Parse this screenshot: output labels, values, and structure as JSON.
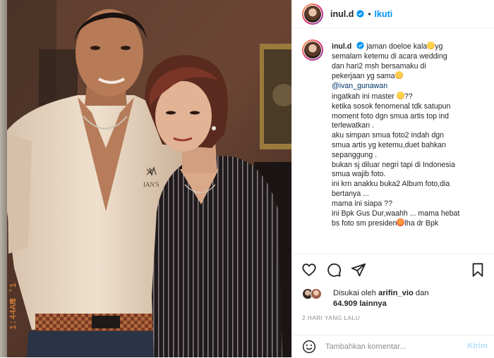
{
  "post": {
    "username": "inul.d",
    "follow_label": "Ikuti",
    "separator": "•",
    "photo_text": {
      "shirt_logo": "IAN'S",
      "date_stamp": "3 '1",
      "time_stamp": "1:44AM"
    }
  },
  "caption": {
    "username": "inul.d",
    "lines": [
      "jaman doeloe kala",
      "semalam ketemu di acara wedding",
      "dan hari2 msh bersamaku di",
      "pekerjaan yg sama",
      "@ivan_gunawan",
      "ingatkah ini master",
      "ketika sosok fenomenal tdk satupun",
      "moment foto dgn smua artis top ind",
      "terlewatkan .",
      "aku simpan smua foto2 indah dgn",
      "smua artis yg ketemu,duet bahkan",
      "sepanggung .",
      "bukan sj diluar negri tapi di Indonesia",
      "smua wajib foto.",
      "ini krn anakku buka2 Album foto,dia",
      "bertanya ...",
      "mama ini siapa ??",
      "ini Bpk Gus Dur,waahh ... mama hebat",
      "bs foto sm presiden",
      "lha dr Bpk"
    ],
    "suffix_yg": "yg",
    "suffix_qq": "??"
  },
  "likes": {
    "prefix": "Disukai oleh",
    "user": "arifin_vio",
    "and": "dan",
    "count": "64.909",
    "others": "lainnya"
  },
  "time_ago": "2 HARI YANG LALU",
  "comment": {
    "placeholder": "Tambahkan komentar...",
    "value": "",
    "send_label": "Kirim"
  },
  "icons": {
    "verified": "verified-badge-icon",
    "like": "heart-icon",
    "comment": "comment-bubble-icon",
    "share": "paper-plane-icon",
    "save": "bookmark-icon",
    "emoji": "smiley-icon"
  },
  "colors": {
    "accent": "#0095f6",
    "mention": "#00376b",
    "muted": "#8e8e8e",
    "send_disabled": "#b2dffc"
  }
}
